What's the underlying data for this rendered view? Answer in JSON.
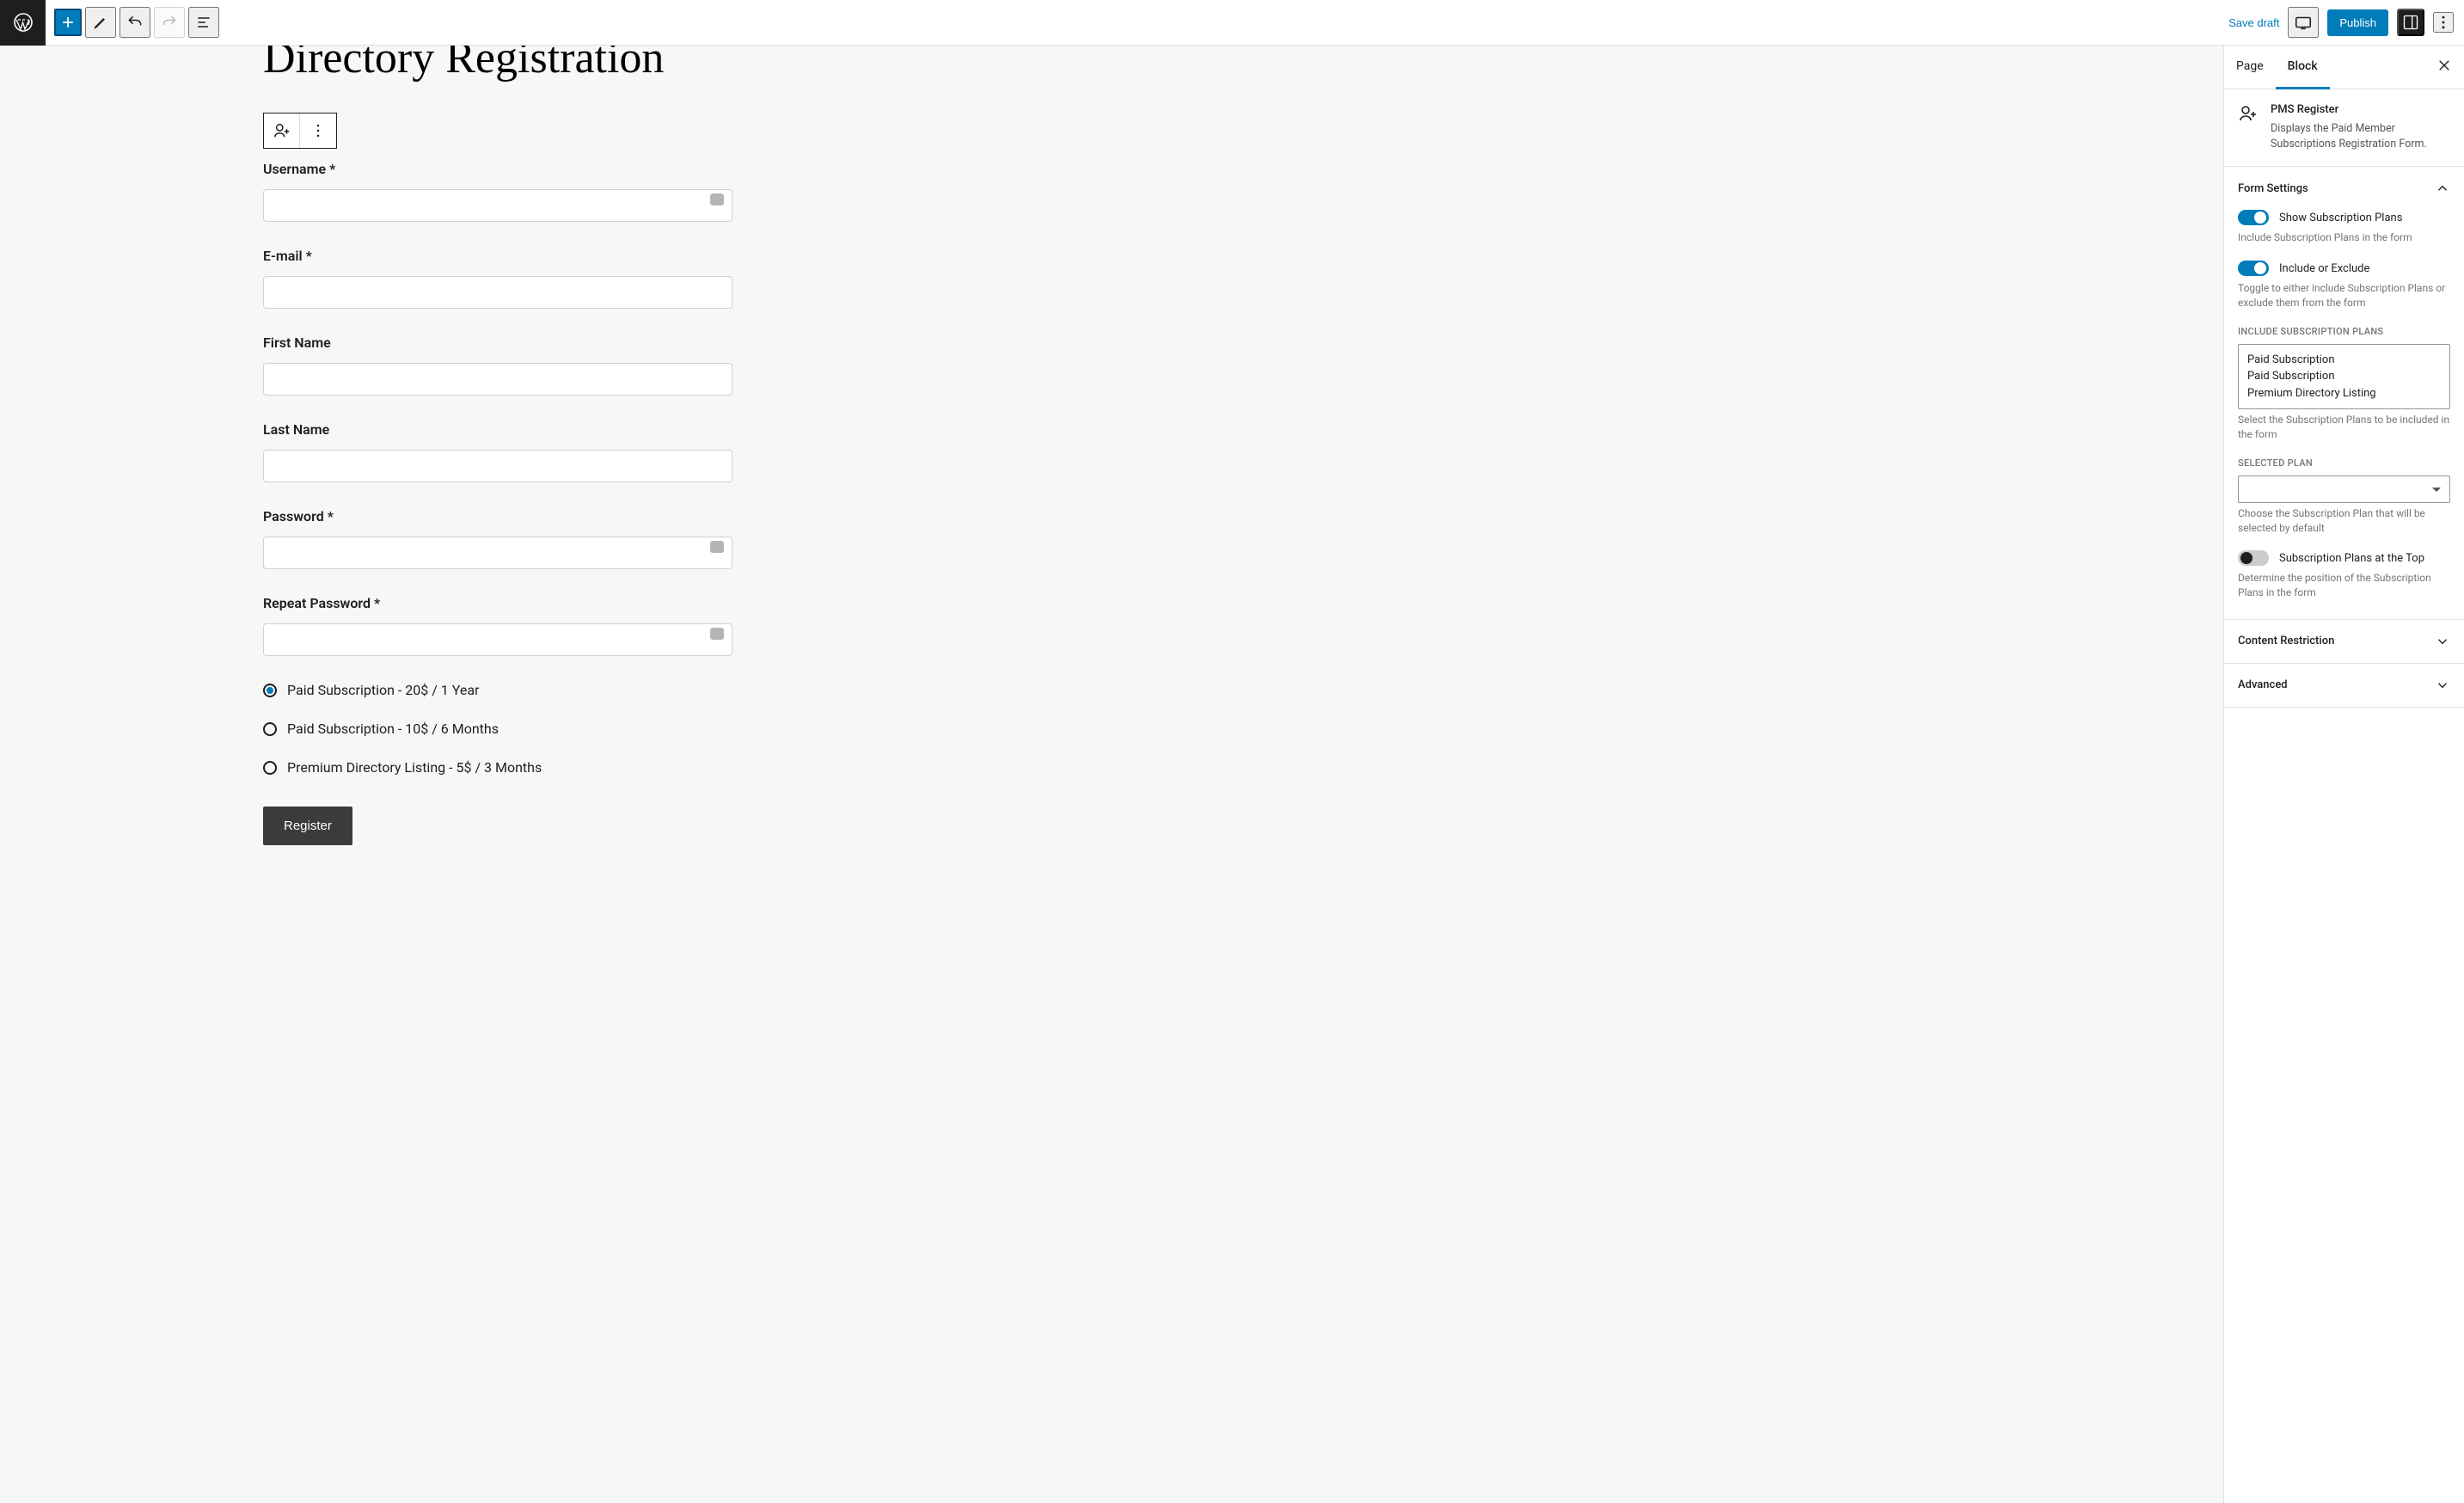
{
  "toolbar": {
    "save_draft": "Save draft",
    "publish": "Publish"
  },
  "page": {
    "title": "Directory Registration"
  },
  "form": {
    "labels": {
      "username": "Username *",
      "email": "E-mail *",
      "first_name": "First Name",
      "last_name": "Last Name",
      "password": "Password *",
      "repeat_password": "Repeat Password *"
    },
    "plans": [
      {
        "label": "Paid Subscription - 20$ / 1 Year",
        "selected": true
      },
      {
        "label": "Paid Subscription - 10$ / 6 Months",
        "selected": false
      },
      {
        "label": "Premium Directory Listing - 5$ / 3 Months",
        "selected": false
      }
    ],
    "register_btn": "Register"
  },
  "sidebar": {
    "tabs": {
      "page": "Page",
      "block": "Block"
    },
    "block": {
      "name": "PMS Register",
      "desc": "Displays the Paid Member Subscriptions Registration Form."
    },
    "form_settings": {
      "title": "Form Settings",
      "show_plans": {
        "label": "Show Subscription Plans",
        "help": "Include Subscription Plans in the form"
      },
      "include_exclude": {
        "label": "Include or Exclude",
        "help": "Toggle to either include Subscription Plans or exclude them from the form"
      },
      "include_plans": {
        "label": "Include Subscription Plans",
        "options": [
          "Paid Subscription",
          "Paid Subscription",
          "Premium Directory Listing"
        ],
        "help": "Select the Subscription Plans to be included in the form"
      },
      "selected_plan": {
        "label": "Selected Plan",
        "help": "Choose the Subscription Plan that will be selected by default"
      },
      "plans_top": {
        "label": "Subscription Plans at the Top",
        "help": "Determine the position of the Subscription Plans in the form"
      }
    },
    "content_restriction": "Content Restriction",
    "advanced": "Advanced"
  }
}
